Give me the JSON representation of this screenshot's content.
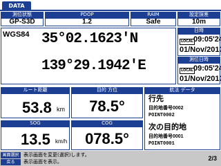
{
  "header": {
    "tab_label": "DATA"
  },
  "status_row": {
    "cols": [
      {
        "label": "測位状態",
        "value": "GP-S3D"
      },
      {
        "label": "PDOP",
        "value": "1.2"
      },
      {
        "label": "RAIM",
        "value": "Safe"
      },
      {
        "label": "設定誤差",
        "value": "10m"
      }
    ]
  },
  "position": {
    "datum": "WGS84",
    "latitude": "35°02.1623'N",
    "longitude": "139°29.1942'E"
  },
  "datetime": {
    "label": "日時",
    "local_badge": "LOCAL",
    "time": "09:05'24",
    "date": "01/Nov/2013"
  },
  "fix_time": {
    "label": "測位日時",
    "local_badge": "LOCAL",
    "time": "09:05'24",
    "date": "01/Nov/2013"
  },
  "route_distance": {
    "label": "ルート距離",
    "value": "53.8",
    "unit": "km"
  },
  "bearing": {
    "label": "目的 方位",
    "value": "78.5°"
  },
  "sog": {
    "label": "SOG",
    "value": "13.5",
    "unit": "km/h"
  },
  "cog": {
    "label": "COG",
    "value": "078.5°"
  },
  "nav_data": {
    "label": "航法 データ",
    "dest_title": "行先",
    "dest_name": "目的地番号0002",
    "dest_point": "POINT0002",
    "next_title": "次の目的地",
    "next_name": "目的地番号0001",
    "next_point": "POINT0001"
  },
  "footer": {
    "btn1": "画面選択",
    "btn2": "戻る",
    "line1": "表示画面を変更(選択)します。",
    "line2": "表示画面を表示。",
    "page": "2/3"
  }
}
